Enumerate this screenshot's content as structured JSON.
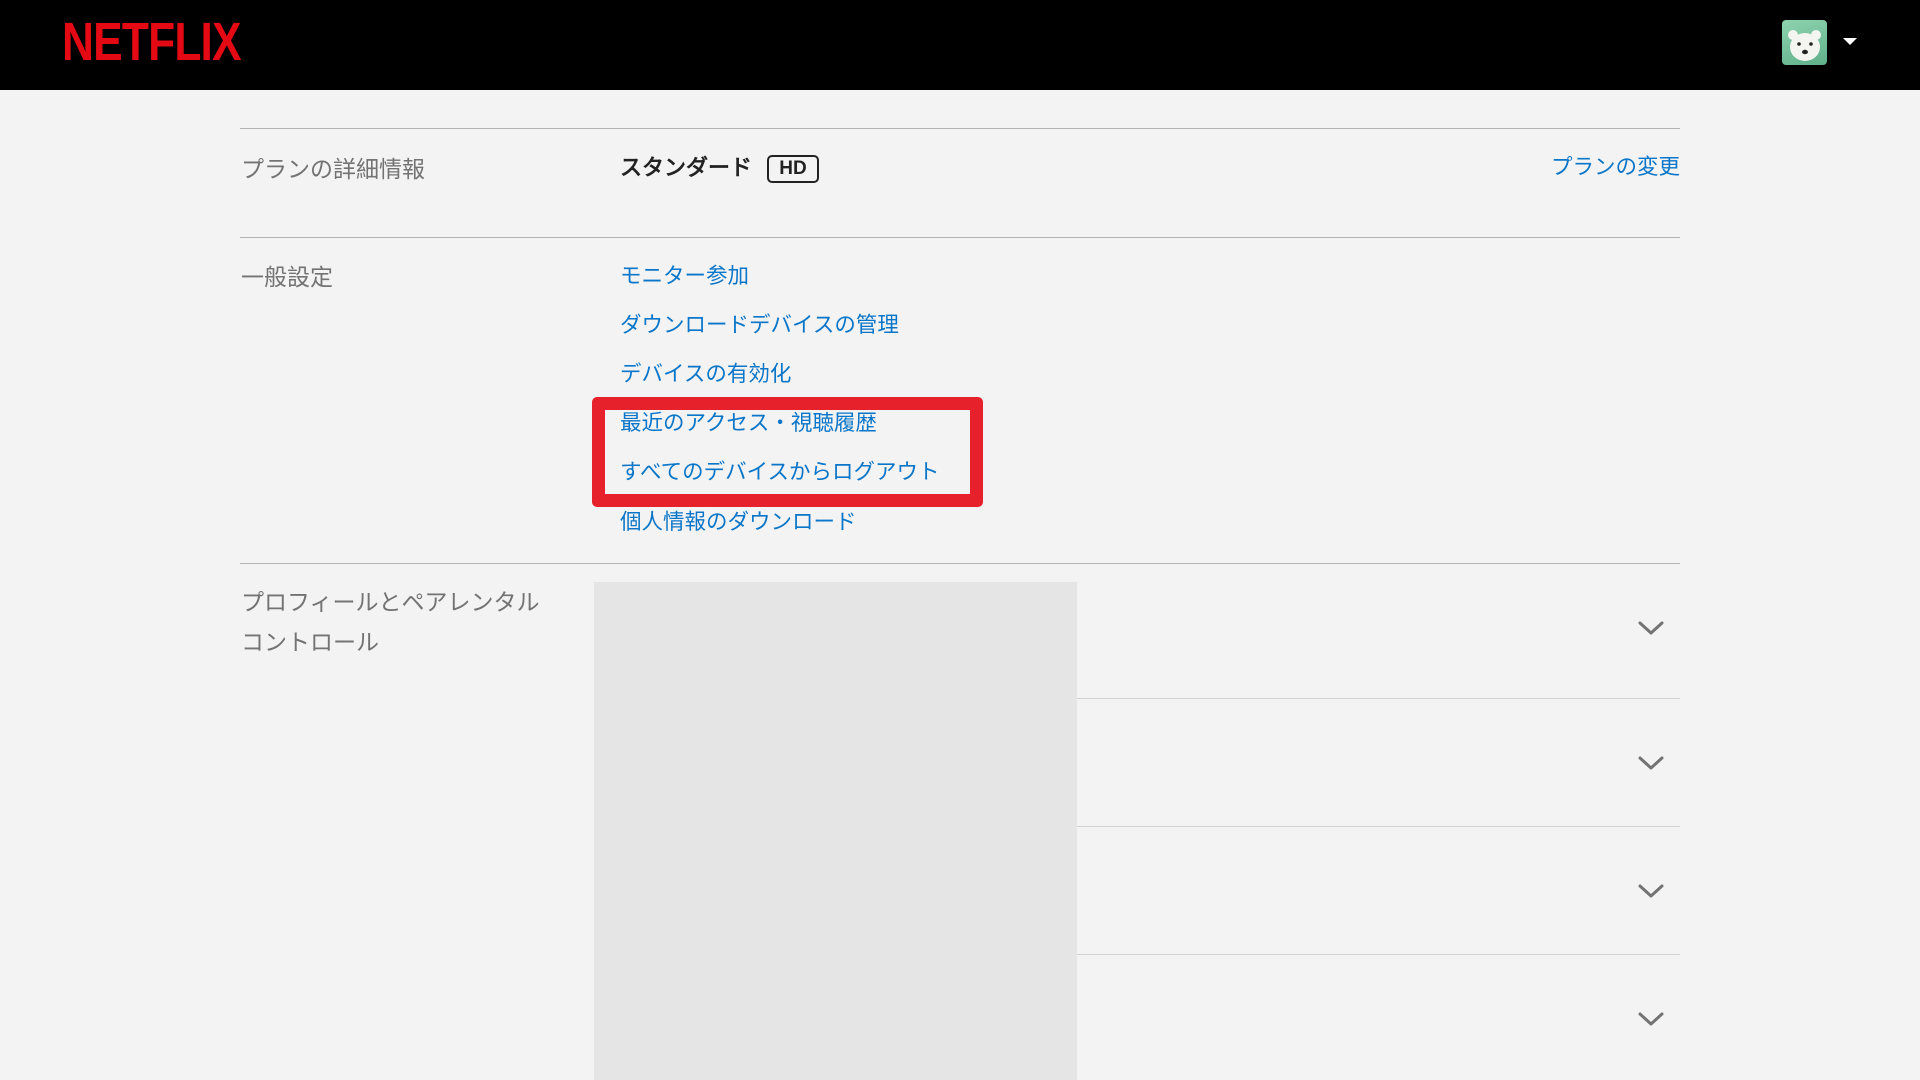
{
  "header": {
    "logo_text": "NETFLIX",
    "avatar_icon": "polar-bear-avatar-icon",
    "caret_icon": "caret-down-icon"
  },
  "plan": {
    "label": "プランの詳細情報",
    "name": "スタンダード",
    "badge": "HD",
    "change_link": "プランの変更"
  },
  "general": {
    "label": "一般設定",
    "links": [
      "モニター参加",
      "ダウンロードデバイスの管理",
      "デバイスの有効化",
      "最近のアクセス・視聴履歴",
      "すべてのデバイスからログアウト",
      "個人情報のダウンロード"
    ]
  },
  "profiles": {
    "label_line1": "プロフィールとペアレンタル",
    "label_line2": "コントロール",
    "row_icon": "chevron-down-icon"
  },
  "colors": {
    "brand": "#e50914",
    "link": "#0a76c9",
    "highlight": "#e6212b"
  }
}
